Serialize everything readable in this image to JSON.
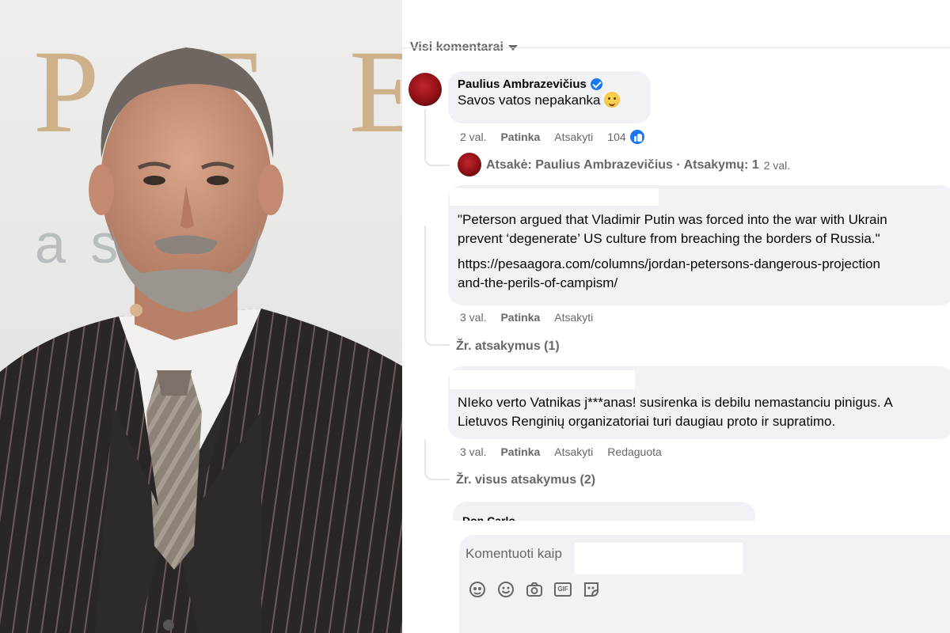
{
  "photo": {
    "backdrop_word": "P T E",
    "backdrop_sub": "a sveta"
  },
  "comments_panel": {
    "sort_label": "Visi komentarai",
    "comments": [
      {
        "author": "Paulius Ambrazevičius",
        "verified": true,
        "text": "Savos vatos nepakanka",
        "time": "2 val.",
        "like_label": "Patinka",
        "reply_label": "Atsakyti",
        "reaction_count": "104",
        "reply_preview": {
          "text": "Atsakė: Paulius Ambrazevičius · Atsakymų: 1",
          "time": "2 val."
        }
      },
      {
        "author": "",
        "text_lines": [
          "\"Peterson argued that Vladimir Putin was forced into the war with Ukrain",
          "prevent ‘degenerate’ US culture from breaching the borders of Russia.\""
        ],
        "link_lines": [
          "https://pesaagora.com/columns/jordan-petersons-dangerous-projection",
          "and-the-perils-of-campism/"
        ],
        "time": "3 val.",
        "like_label": "Patinka",
        "reply_label": "Atsakyti",
        "view_replies": "Žr. atsakymus (1)"
      },
      {
        "author": "",
        "text_lines": [
          "NIeko verto Vatnikas j***anas! susirenka is debilu nemastanciu pinigus. A",
          "Lietuvos Renginių organizatoriai turi daugiau proto ir supratimo."
        ],
        "time": "3 val.",
        "like_label": "Patinka",
        "reply_label": "Atsakyti",
        "edited_label": "Redaguota",
        "view_replies": "Žr. visus atsakymus (2)"
      },
      {
        "author": "Don Carlo"
      }
    ],
    "composer": {
      "placeholder": "Komentuoti kaip",
      "icons": [
        "avatar-sticker-icon",
        "emoji-icon",
        "camera-icon",
        "gif-icon",
        "sticker-icon"
      ],
      "gif_text": "GIF"
    }
  },
  "colors": {
    "bubble": "#f0f2f5",
    "secondary_text": "#65676b",
    "facebook_blue": "#1877f2"
  }
}
